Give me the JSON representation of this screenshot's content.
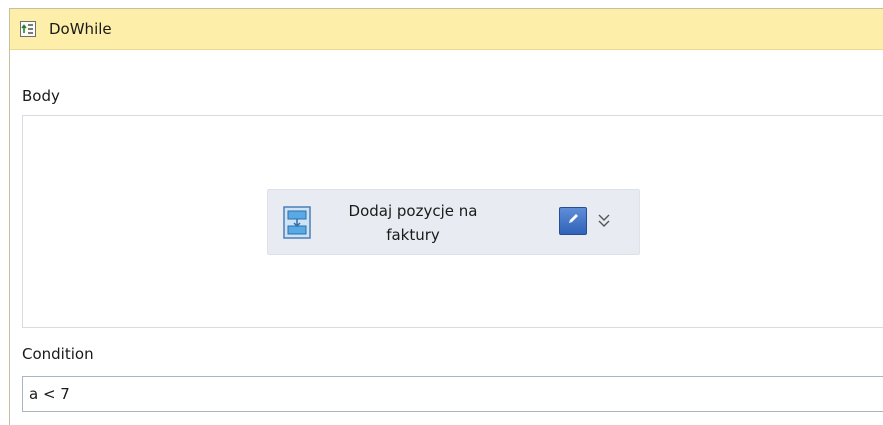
{
  "activity_header": {
    "title": "DoWhile",
    "icon": "dowhile-icon"
  },
  "body_section": {
    "label": "Body",
    "child_activity": {
      "line1": "Dodaj pozycje na",
      "line2": "faktury",
      "icon": "sequence-activity-icon",
      "edit_icon": "pencil-icon",
      "expand_icon": "double-chevron-down-icon"
    }
  },
  "condition_section": {
    "label": "Condition",
    "value": "a < 7"
  },
  "colors": {
    "header_bg": "#fdefa9",
    "activity_bg": "#e8ecf2",
    "edit_button": "#3d70c4"
  }
}
